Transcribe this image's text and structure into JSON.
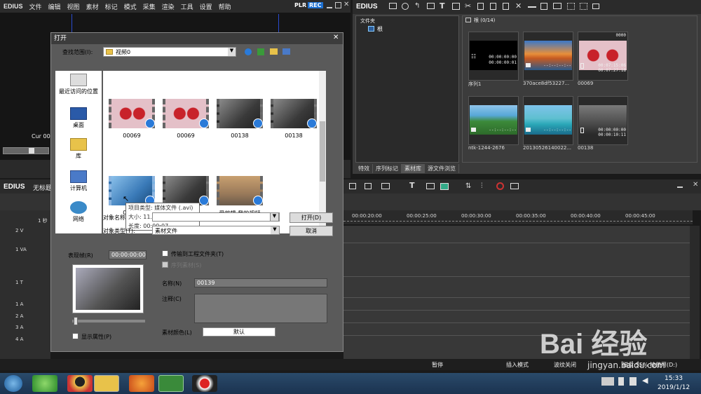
{
  "app": {
    "logo": "EDIUS",
    "menu": [
      "文件",
      "编辑",
      "视图",
      "素材",
      "标记",
      "模式",
      "采集",
      "渲染",
      "工具",
      "设置",
      "帮助"
    ],
    "plr": "PLR",
    "rec": "REC",
    "cur_label": "Cur 00"
  },
  "bin": {
    "logo": "EDIUS",
    "folder_header": "文件夹",
    "root": "根",
    "bin_header": "根 (0/14)",
    "tabs": [
      "特效",
      "序列标记",
      "素材库",
      "源文件浏览"
    ],
    "clips": [
      {
        "label": "序列1",
        "tc1": "00:00:00:00",
        "tc2": "00:00:00:01",
        "type": "sequence",
        "top_tc": ""
      },
      {
        "label": "370ace8df53227...",
        "tc1": "--:--:--:--",
        "tc2": "--:--:--:--",
        "type": "image",
        "top_tc": ""
      },
      {
        "label": "00069",
        "tc1": "00:07:15:06",
        "tc2": "00:07:27:18",
        "type": "video",
        "top_tc": "0000"
      },
      {
        "label": "ntk-1244-2676",
        "tc1": "--:--:--:--",
        "tc2": "--:--:--:--",
        "type": "image",
        "top_tc": ""
      },
      {
        "label": "20130526140022...",
        "tc1": "--:--:--:--",
        "tc2": "--:--:--:--",
        "type": "image",
        "top_tc": ""
      },
      {
        "label": "00138",
        "tc1": "00:00:00:00",
        "tc2": "00:00:10:11",
        "type": "video",
        "top_tc": ""
      }
    ]
  },
  "timeline": {
    "logo": "EDIUS",
    "title": "无标题",
    "ruler": [
      "00:00:20:00",
      "00:00:25:00",
      "00:00:30:00",
      "00:00:35:00",
      "00:00:40:00",
      "00:00:45:00"
    ],
    "tracks": [
      "2 V",
      "1 VA",
      "1 T",
      "1 A",
      "2 A",
      "3 A",
      "4 A"
    ],
    "first_row": "1 秒"
  },
  "status": {
    "pause": "暂停",
    "insert_mode": "插入模式",
    "ripple": "波纹关闭",
    "disk": "磁盘:55% 被使用(D:)"
  },
  "dialog": {
    "title": "打开",
    "lookin_label": "查找范围(I):",
    "lookin_value": "视频0",
    "places": [
      "最近访问的位置",
      "桌面",
      "库",
      "计算机",
      "网络"
    ],
    "files": [
      "00069",
      "00069",
      "00138",
      "00138",
      "00139",
      "",
      "爱剪辑-我的视频"
    ],
    "tooltip": [
      "项目类型: 媒体文件 (.avi)",
      "大小: 11.6 MB",
      "长度: 00:00:07"
    ],
    "filename_label": "对象名称",
    "filetype_label": "对象类型(T):",
    "filetype_value": "素材文件",
    "open_btn": "打开(D)",
    "cancel_btn": "取消",
    "preview_label": "表现帧(R)",
    "preview_tc": "00:00:00:00",
    "transfer_chk": "传输到工程文件夹(T)",
    "seq_chk": "序列素材(S)",
    "name_label": "名称(N)",
    "name_value": "00139",
    "comment_label": "注释(C)",
    "color_label": "素材颜色(L)",
    "color_value": "默认",
    "show_props": "显示属性(P)"
  },
  "taskbar": {
    "time": "15:33",
    "date": "2019/1/12"
  },
  "watermark": {
    "brand": "Bai 经验",
    "url": "jingyan.baidu.com"
  }
}
